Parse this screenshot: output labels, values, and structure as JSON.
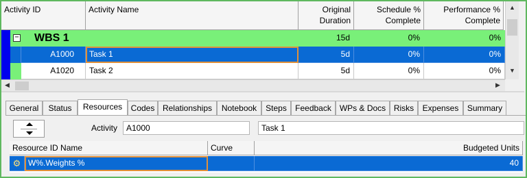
{
  "activity_table": {
    "headers": {
      "activity_id": "Activity ID",
      "activity_name": "Activity Name",
      "original_duration": [
        "Original",
        "Duration"
      ],
      "schedule_pct": [
        "Schedule %",
        "Complete"
      ],
      "performance_pct": [
        "Performance %",
        "Complete"
      ]
    },
    "rows": [
      {
        "type": "wbs",
        "expand": "−",
        "id": "",
        "name": "WBS 1",
        "duration": "15d",
        "schedule": "0%",
        "performance": "0%"
      },
      {
        "type": "selected",
        "id": "A1000",
        "name": "Task 1",
        "duration": "5d",
        "schedule": "0%",
        "performance": "0%"
      },
      {
        "type": "normal",
        "id": "A1020",
        "name": "Task 2",
        "duration": "5d",
        "schedule": "0%",
        "performance": "0%"
      }
    ]
  },
  "tabs": [
    {
      "label": "General"
    },
    {
      "label": "Status"
    },
    {
      "label": "Resources",
      "active": true
    },
    {
      "label": "Codes"
    },
    {
      "label": "Relationships"
    },
    {
      "label": "Notebook"
    },
    {
      "label": "Steps"
    },
    {
      "label": "Feedback"
    },
    {
      "label": "WPs & Docs"
    },
    {
      "label": "Risks"
    },
    {
      "label": "Expenses"
    },
    {
      "label": "Summary"
    }
  ],
  "detail": {
    "activity_label": "Activity",
    "activity_id": "A1000",
    "activity_name": "Task 1"
  },
  "resource_table": {
    "headers": {
      "resource_id_name": "Resource ID Name",
      "curve": "Curve",
      "budgeted_units": "Budgeted Units"
    },
    "rows": [
      {
        "icon": "gear-icon",
        "resource": "W%.Weights %",
        "curve": "",
        "budgeted_units": "40"
      }
    ]
  },
  "colors": {
    "wbs_row": "#79f079",
    "selection": "#0a6ad4",
    "focus": "#e0903a",
    "frame": "#5fb85f"
  }
}
